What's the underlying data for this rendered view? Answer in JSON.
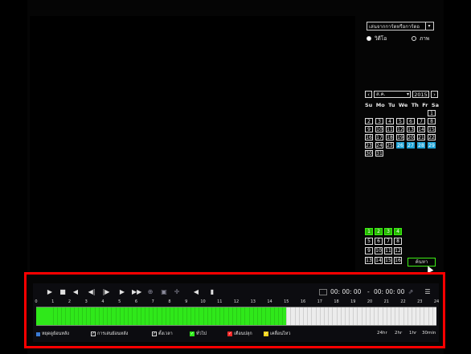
{
  "colors": {
    "accent_green": "#2fe81a",
    "highlight_blue": "#1fa3d6",
    "panel_border": "#ff0000"
  },
  "sidebar": {
    "source": "เล่นจากการ์ดหรือการ์ดอ",
    "radio": [
      {
        "label": "วิดีโอ",
        "selected": true
      },
      {
        "label": "ภาพ",
        "selected": false
      }
    ],
    "calendar": {
      "month": "ส.ค.",
      "year": "2015",
      "weekdays": [
        "Su",
        "Mo",
        "Tu",
        "We",
        "Th",
        "Fr",
        "Sa"
      ],
      "days": [
        "1",
        "2",
        "3",
        "4",
        "5",
        "6",
        "7",
        "8",
        "9",
        "10",
        "11",
        "12",
        "13",
        "14",
        "15",
        "16",
        "17",
        "18",
        "19",
        "20",
        "21",
        "22",
        "23",
        "24",
        "25",
        "26",
        "27",
        "28",
        "29",
        "30",
        "31"
      ],
      "highlighted_days": [
        "26",
        "27",
        "28",
        "29"
      ]
    },
    "channels": [
      {
        "label": "1",
        "active": true
      },
      {
        "label": "2",
        "active": true
      },
      {
        "label": "3",
        "active": true
      },
      {
        "label": "4",
        "active": true
      },
      {
        "label": "5",
        "active": false
      },
      {
        "label": "6",
        "active": false
      },
      {
        "label": "7",
        "active": false
      },
      {
        "label": "8",
        "active": false
      },
      {
        "label": "9",
        "active": false
      },
      {
        "label": "10",
        "active": false
      },
      {
        "label": "11",
        "active": false
      },
      {
        "label": "12",
        "active": false
      },
      {
        "label": "13",
        "active": false
      },
      {
        "label": "14",
        "active": false
      },
      {
        "label": "15",
        "active": false
      },
      {
        "label": "16",
        "active": false
      }
    ],
    "search_label": "ค้นหา"
  },
  "playback": {
    "icons": [
      "play-icon",
      "stop-icon",
      "rewind-icon",
      "step-back-icon",
      "step-forward-icon",
      "slow-forward-icon",
      "fast-forward-icon",
      "zoom-icon",
      "snapshot-icon",
      "crosshair-icon",
      "volume-icon",
      "volume-slider-icon"
    ],
    "time_start": "00: 00: 00",
    "time_sep": "-",
    "time_end": "00: 00: 00",
    "hours": [
      "0",
      "1",
      "2",
      "3",
      "4",
      "5",
      "6",
      "7",
      "8",
      "9",
      "10",
      "11",
      "12",
      "13",
      "14",
      "15",
      "16",
      "17",
      "18",
      "19",
      "20",
      "21",
      "22",
      "23",
      "24"
    ],
    "recorded_until_hour": 15,
    "legend": [
      {
        "label": "หยุดดูย้อนหลัง",
        "checked": null,
        "color": "#3a7bd5"
      },
      {
        "label": "การเล่นย้อนหลัง",
        "checked": true,
        "color": ""
      },
      {
        "label": "ตั้งเวลา",
        "checked": true,
        "color": ""
      },
      {
        "label": "ทั่วไป",
        "checked": true,
        "color": "#2fe81a"
      },
      {
        "label": "เตือนปลุก",
        "checked": true,
        "color": "#ff2a2a"
      },
      {
        "label": "เคลื่อนไหว",
        "checked": true,
        "color": "#f2d21a"
      }
    ],
    "zoom_levels": [
      "24hr",
      "2hr",
      "1hr",
      "30min"
    ]
  }
}
